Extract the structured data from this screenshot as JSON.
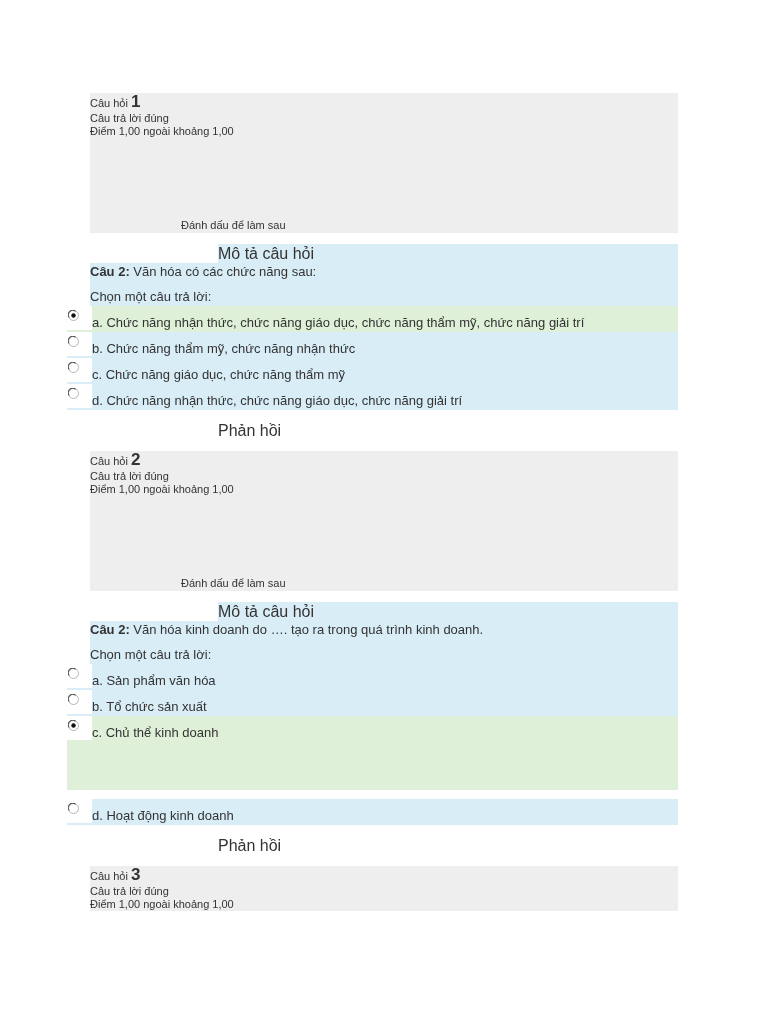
{
  "questions": [
    {
      "number_label": "Câu hỏi",
      "number": "1",
      "status": "Câu trả lời đúng",
      "grade": "Điểm 1,00 ngoài khoảng 1,00",
      "flag": "Đánh dấu để làm sau",
      "description_heading": "Mô tả câu hỏi",
      "question_text": "**Câu 2:** Văn hóa có các chức năng sau:",
      "prompt": "Chọn một câu trả lời:",
      "answers": [
        {
          "label": "a. Chức năng nhận thức, chức năng giáo dục, chức năng thẩm mỹ, chức năng giải trí",
          "selected": true
        },
        {
          "label": "b. Chức năng thẩm mỹ, chức năng nhận thức",
          "selected": false
        },
        {
          "label": "c. Chức năng giáo dục, chức năng thẩm mỹ",
          "selected": false
        },
        {
          "label": "d. Chức năng nhận thức, chức năng giáo dục, chức năng giải trí",
          "selected": false
        }
      ],
      "feedback_heading": "Phản hồi"
    },
    {
      "number_label": "Câu hỏi",
      "number": "2",
      "status": "Câu trả lời đúng",
      "grade": "Điểm 1,00 ngoài khoảng 1,00",
      "flag": "Đánh dấu để làm sau",
      "description_heading": "Mô tả câu hỏi",
      "question_text": "**Câu 2:** Văn hóa kinh doanh do …. tạo ra trong quá trình kinh doanh.",
      "prompt": "Chọn một câu trả lời:",
      "answers": [
        {
          "label": "a. Sản phẩm văn hóa",
          "selected": false
        },
        {
          "label": "b. Tổ chức sản xuất",
          "selected": false
        },
        {
          "label": "c. Chủ thể kinh doanh",
          "selected": true
        },
        {
          "label": "d. Hoạt động kinh doanh",
          "selected": false
        }
      ],
      "feedback_heading": "Phản hồi"
    },
    {
      "number_label": "Câu hỏi",
      "number": "3",
      "status": "Câu trả lời đúng",
      "grade": "Điểm 1,00 ngoài khoảng 1,00"
    }
  ]
}
